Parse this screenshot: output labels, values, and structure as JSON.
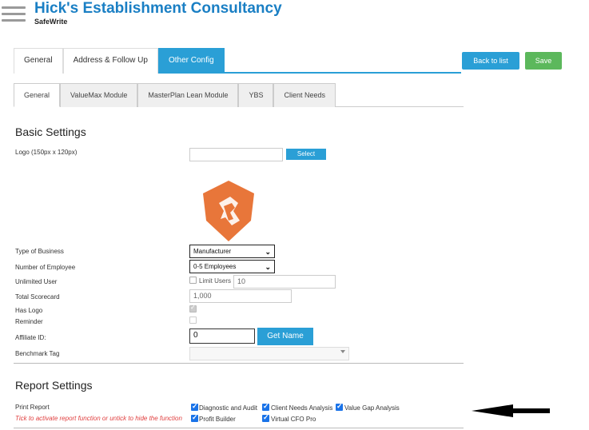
{
  "header": {
    "title": "Hick's Establishment Consultancy",
    "subtitle": "SafeWrite",
    "menu_icon": "hamburger-icon"
  },
  "main_tabs": [
    {
      "label": "General",
      "active": false
    },
    {
      "label": "Address & Follow Up",
      "active": false
    },
    {
      "label": "Other Config",
      "active": true
    }
  ],
  "actions": {
    "back_label": "Back to list",
    "save_label": "Save"
  },
  "sub_tabs": [
    {
      "label": "General",
      "active": true
    },
    {
      "label": "ValueMax Module",
      "active": false
    },
    {
      "label": "MasterPlan Lean Module",
      "active": false
    },
    {
      "label": "YBS",
      "active": false
    },
    {
      "label": "Client Needs",
      "active": false
    }
  ],
  "basic_settings": {
    "title": "Basic Settings",
    "logo_label": "Logo (150px x 120px)",
    "logo_input_value": "",
    "select_button": "Select",
    "type_of_business_label": "Type of Business",
    "type_of_business_value": "Manufacturer",
    "employees_label": "Number of Employee",
    "employees_value": "0-5 Employees",
    "unlimited_user_label": "Unlimited User",
    "limit_users_label": "Limit Users",
    "limit_users_value": "10",
    "total_scorecard_label": "Total Scorecard",
    "total_scorecard_value": "1,000",
    "has_logo_label": "Has Logo",
    "has_logo_checked": true,
    "reminder_label": "Reminder",
    "reminder_checked": false,
    "affiliate_label": "Affiliate ID:",
    "affiliate_value": "0",
    "get_name_button": "Get Name",
    "benchmark_label": "Benchmark Tag",
    "benchmark_value": ""
  },
  "report_settings": {
    "title": "Report Settings",
    "print_report_label": "Print Report",
    "hint": "Tick to activate report function or untick to hide the function",
    "options": [
      {
        "label": "Diagnostic and Audit",
        "checked": true
      },
      {
        "label": "Client Needs Analysis",
        "checked": true
      },
      {
        "label": "Value Gap Analysis",
        "checked": true
      },
      {
        "label": "Profit Builder",
        "checked": true
      },
      {
        "label": "Virtual CFO Pro",
        "checked": true
      }
    ]
  },
  "colors": {
    "primary": "#2a9fd6",
    "save": "#5cb85c",
    "title_blue": "#1a7fc4",
    "logo_orange": "#e8763a",
    "hint_red": "#e04040"
  }
}
